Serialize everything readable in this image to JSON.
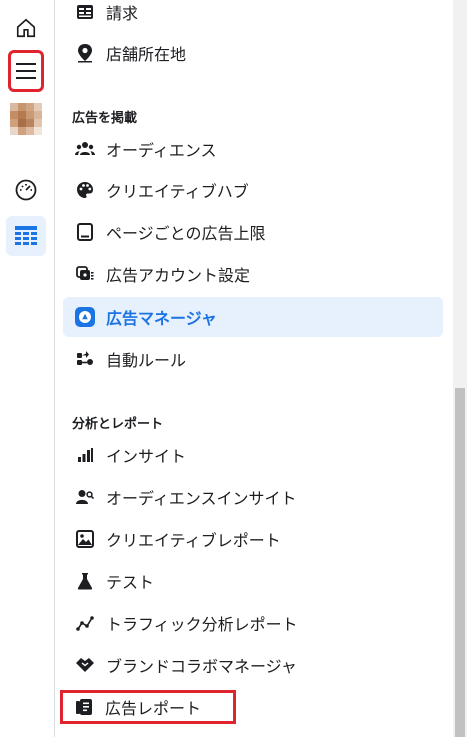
{
  "menu": {
    "items_top": [
      {
        "label": "請求",
        "icon": "billing-icon"
      },
      {
        "label": "店舗所在地",
        "icon": "location-pin-icon"
      }
    ],
    "sections": [
      {
        "title": "広告を掲載",
        "items": [
          {
            "label": "オーディエンス",
            "icon": "audience-icon"
          },
          {
            "label": "クリエイティブハブ",
            "icon": "palette-icon"
          },
          {
            "label": "ページごとの広告上限",
            "icon": "tablet-icon"
          },
          {
            "label": "広告アカウント設定",
            "icon": "account-settings-icon"
          },
          {
            "label": "広告マネージャ",
            "icon": "ads-manager-icon"
          },
          {
            "label": "自動ルール",
            "icon": "automated-rules-icon"
          }
        ]
      },
      {
        "title": "分析とレポート",
        "items": [
          {
            "label": "インサイト",
            "icon": "bar-chart-icon"
          },
          {
            "label": "オーディエンスインサイト",
            "icon": "audience-insights-icon"
          },
          {
            "label": "クリエイティブレポート",
            "icon": "image-icon"
          },
          {
            "label": "テスト",
            "icon": "flask-icon"
          },
          {
            "label": "トラフィック分析レポート",
            "icon": "traffic-analysis-icon"
          },
          {
            "label": "ブランドコラボマネージャ",
            "icon": "handshake-icon"
          },
          {
            "label": "広告レポート",
            "icon": "report-icon"
          }
        ]
      }
    ]
  },
  "colors": {
    "accent": "#1b74e4",
    "highlight": "#e0242f",
    "active_bg": "#e7f0fd"
  }
}
